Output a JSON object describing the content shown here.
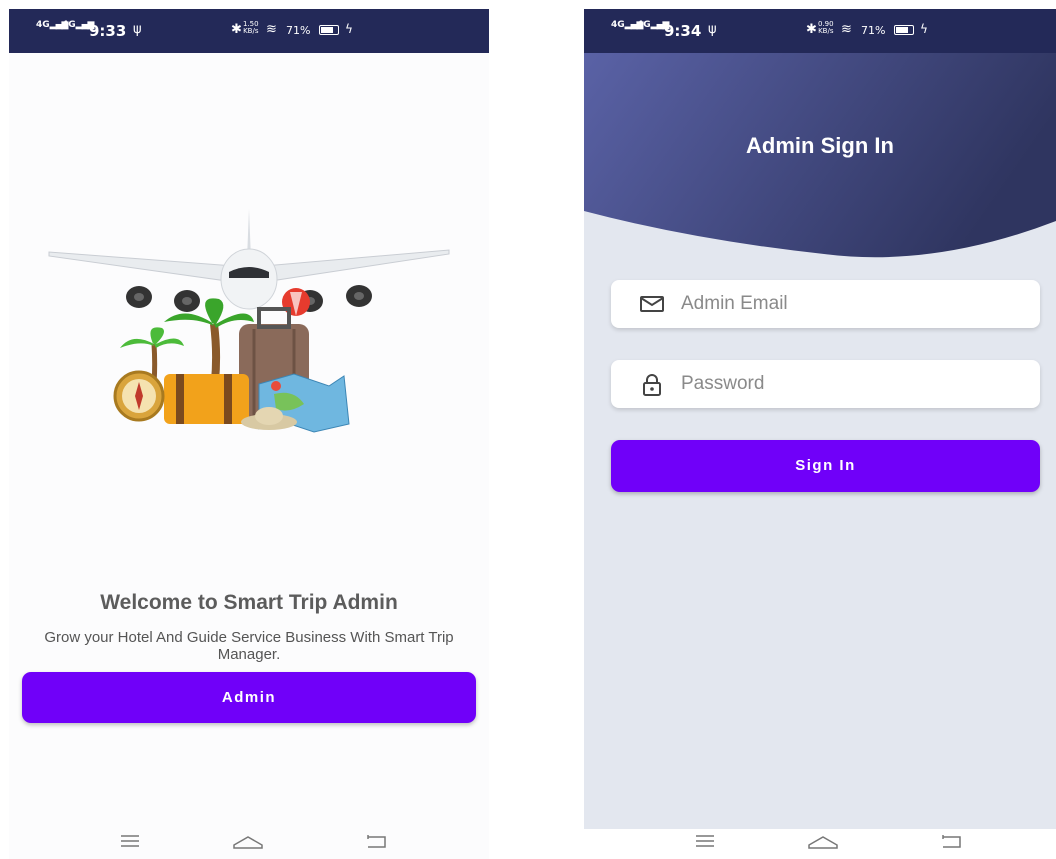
{
  "welcome_screen": {
    "status": {
      "signal_1": "4G",
      "signal_2": "4G",
      "time": "9:33",
      "speed": "1.50",
      "speed_unit": "KB/s",
      "battery": "71%"
    },
    "title": "Welcome to Smart Trip Admin",
    "subtitle": "Grow your Hotel And Guide Service Business With Smart Trip Manager.",
    "admin_button": "Admin"
  },
  "signin_screen": {
    "status": {
      "signal_1": "4G",
      "signal_2": "4G",
      "time": "9:34",
      "speed": "0.90",
      "speed_unit": "KB/s",
      "battery": "71%"
    },
    "title": "Admin Sign In",
    "email_placeholder": "Admin Email",
    "password_placeholder": "Password",
    "signin_button": "Sign In"
  },
  "icons": [
    "signal-icon",
    "usb-icon",
    "bluetooth-icon",
    "wifi-icon",
    "battery-icon",
    "charging-icon",
    "menu-icon",
    "home-icon",
    "back-icon",
    "mail-icon",
    "lock-icon"
  ],
  "colors": {
    "status_bar": "#232958",
    "primary_button": "#7000f9",
    "header_gradient_start": "#5a62a6",
    "header_gradient_end": "#2f3560",
    "signin_background": "#e3e7ef"
  }
}
